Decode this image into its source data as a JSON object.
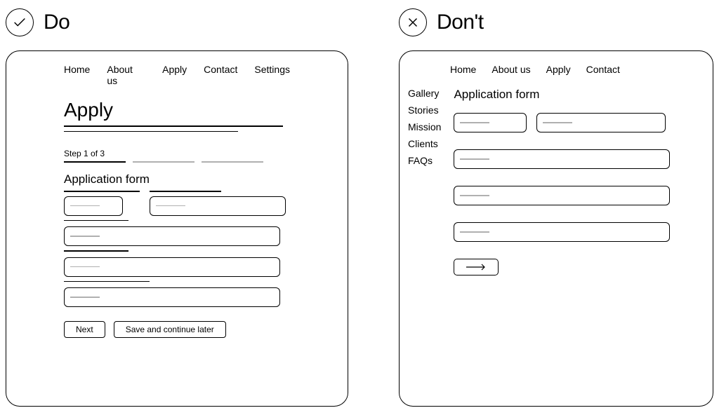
{
  "do": {
    "heading": "Do",
    "nav": [
      "Home",
      "About us",
      "Apply",
      "Contact",
      "Settings"
    ],
    "page_title": "Apply",
    "step_text": "Step 1 of 3",
    "section_title": "Application form",
    "buttons": {
      "next": "Next",
      "save": "Save and continue later"
    }
  },
  "dont": {
    "heading": "Don't",
    "nav": [
      "Home",
      "About us",
      "Apply",
      "Contact"
    ],
    "sidenav": [
      "Gallery",
      "Stories",
      "Mission",
      "Clients",
      "FAQs"
    ],
    "section_title": "Application form"
  }
}
